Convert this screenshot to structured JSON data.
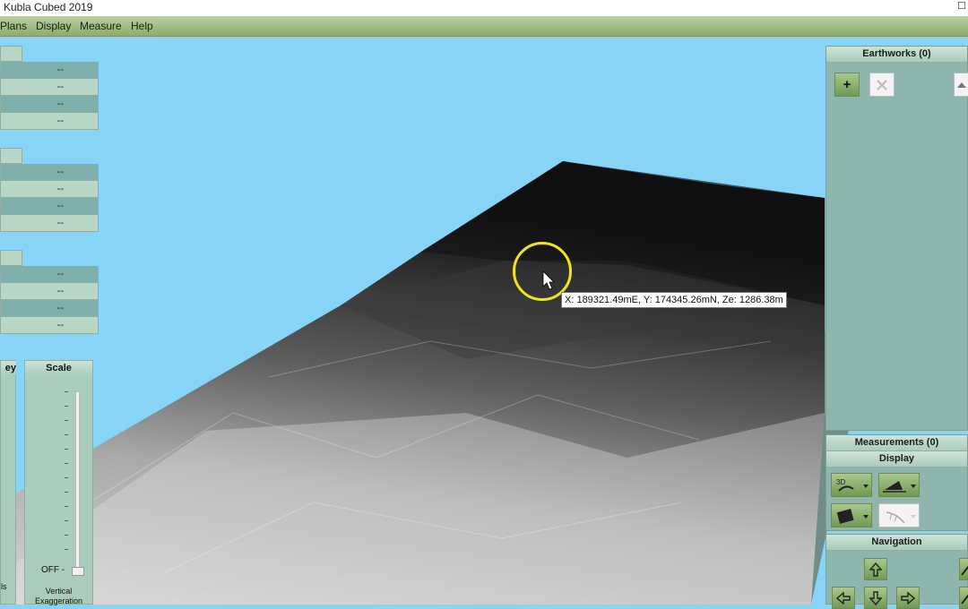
{
  "window": {
    "title": "Kubla Cubed 2019",
    "max_glyph": "☐"
  },
  "menu": [
    "Plans",
    "Display",
    "Measure",
    "Help"
  ],
  "values_panels": [
    {
      "rows": [
        "--",
        "--",
        "--",
        "--"
      ]
    },
    {
      "rows": [
        "--",
        "--",
        "--",
        "--"
      ]
    },
    {
      "rows": [
        "--",
        "--",
        "--",
        "--"
      ]
    }
  ],
  "key_panel": {
    "label": "ey",
    "bottom_text": "ls"
  },
  "scale_panel": {
    "title": "Scale",
    "off_label": "OFF -",
    "caption_1": "Vertical",
    "caption_2": "Exaggeration"
  },
  "tooltip": {
    "text": "X: 189321.49mE, Y: 174345.26mN, Ze: 1286.38m"
  },
  "earthworks": {
    "title": "Earthworks (0)",
    "add_label": "+"
  },
  "measurements": {
    "title": "Measurements (0)"
  },
  "display": {
    "title": "Display"
  },
  "navigation": {
    "title": "Navigation"
  },
  "colors": {
    "sky": "#87d4f7",
    "menu_green": "#8eab6e",
    "panel_teal": "#8fb6ac",
    "terrain_light": "#d8d8d8",
    "terrain_dark": "#1a1a1a"
  }
}
